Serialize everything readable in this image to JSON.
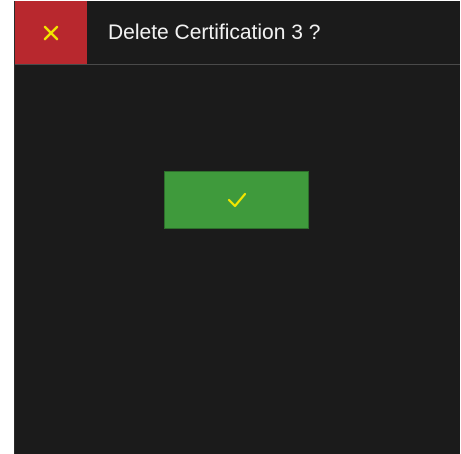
{
  "dialog": {
    "title": "Delete Certification 3 ?"
  },
  "icons": {
    "close": "close-icon",
    "confirm": "checkmark-icon"
  },
  "colors": {
    "background": "#1b1b1b",
    "close_button": "#b8282e",
    "close_icon": "#f2e600",
    "confirm_button": "#3f9a3c",
    "confirm_icon": "#f2e600",
    "title_text": "#f2f2f2"
  }
}
